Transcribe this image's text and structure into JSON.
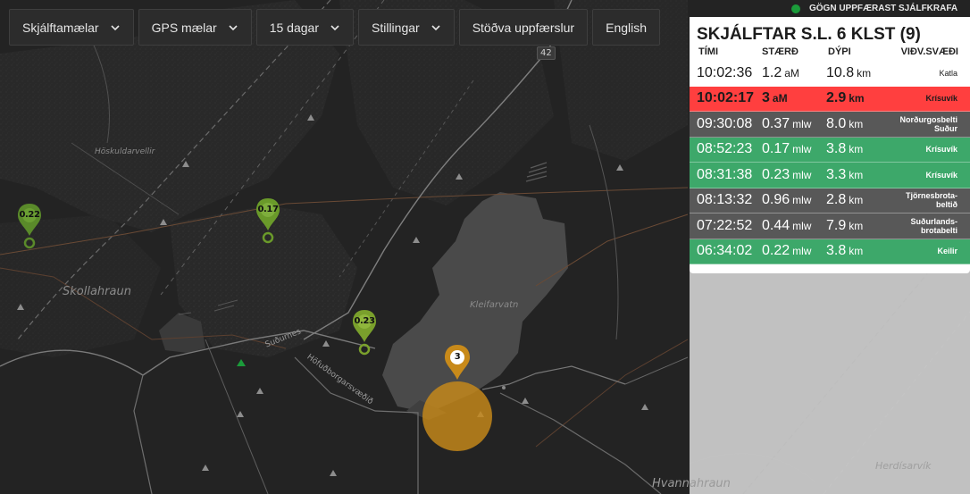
{
  "toolbar": {
    "items": [
      {
        "label": "Skjálftamælar",
        "dropdown": true
      },
      {
        "label": "GPS mælar",
        "dropdown": true
      },
      {
        "label": "15 dagar",
        "dropdown": true
      },
      {
        "label": "Stillingar",
        "dropdown": true
      },
      {
        "label": "Stöðva uppfærslur",
        "dropdown": false
      },
      {
        "label": "English",
        "dropdown": false
      }
    ]
  },
  "status": {
    "text": "GÖGN UPPFÆRAST SJÁLFKRAFA",
    "dot_color": "#1b9b3a"
  },
  "panel": {
    "title": "SKJÁLFTAR S.L. 6 KLST (9)",
    "columns": {
      "time": "TÍMI",
      "magnitude": "STÆRÐ",
      "depth": "DÝPI",
      "area": "VIÐV.SVÆÐI"
    },
    "rows": [
      {
        "time": "10:02:36",
        "magnitude": "1.2",
        "mag_unit": "aM",
        "depth": "10.8",
        "depth_unit": "km",
        "area": "Katla",
        "style": "white"
      },
      {
        "time": "10:02:17",
        "magnitude": "3",
        "mag_unit": "aM",
        "depth": "2.9",
        "depth_unit": "km",
        "area": "Krísuvík",
        "style": "red"
      },
      {
        "time": "09:30:08",
        "magnitude": "0.37",
        "mag_unit": "mlw",
        "depth": "8.0",
        "depth_unit": "km",
        "area": "Norðurgosbelti Suður",
        "style": "gray"
      },
      {
        "time": "08:52:23",
        "magnitude": "0.17",
        "mag_unit": "mlw",
        "depth": "3.8",
        "depth_unit": "km",
        "area": "Krísuvík",
        "style": "green"
      },
      {
        "time": "08:31:38",
        "magnitude": "0.23",
        "mag_unit": "mlw",
        "depth": "3.3",
        "depth_unit": "km",
        "area": "Krísuvík",
        "style": "green"
      },
      {
        "time": "08:13:32",
        "magnitude": "0.96",
        "mag_unit": "mlw",
        "depth": "2.8",
        "depth_unit": "km",
        "area": "Tjörnesbrota-beltið",
        "style": "gray"
      },
      {
        "time": "07:22:52",
        "magnitude": "0.44",
        "mag_unit": "mlw",
        "depth": "7.9",
        "depth_unit": "km",
        "area": "Suðurlands-brotabelti",
        "style": "gray"
      },
      {
        "time": "06:34:02",
        "magnitude": "0.22",
        "mag_unit": "mlw",
        "depth": "3.8",
        "depth_unit": "km",
        "area": "Keilir",
        "style": "green"
      }
    ],
    "colors": {
      "red": "#ff3f3f",
      "green": "#3da86a",
      "gray": "#585858"
    }
  },
  "map": {
    "labels": {
      "hoskuldarvellir": "Höskuldarvellir",
      "skollahraun": "Skollahraun",
      "kleifarvatn": "Kleifarvatn",
      "sudurnes": "Suðurnes",
      "hofudborgarsvaedid": "Höfuðborgarsvæðið",
      "herdisarvik": "Herdísarvík",
      "hvannahraun": "Hvannahraun",
      "road_number": "42",
      "top_cut": "Höfuðborgarsvæðið"
    },
    "markers": [
      {
        "value": "0.22",
        "color": "#5a8a2a"
      },
      {
        "value": "0.17",
        "color": "#6a9a2a"
      },
      {
        "value": "0.23",
        "color": "#7aa02c"
      },
      {
        "value": "3",
        "color": "#c88a1a"
      }
    ]
  }
}
